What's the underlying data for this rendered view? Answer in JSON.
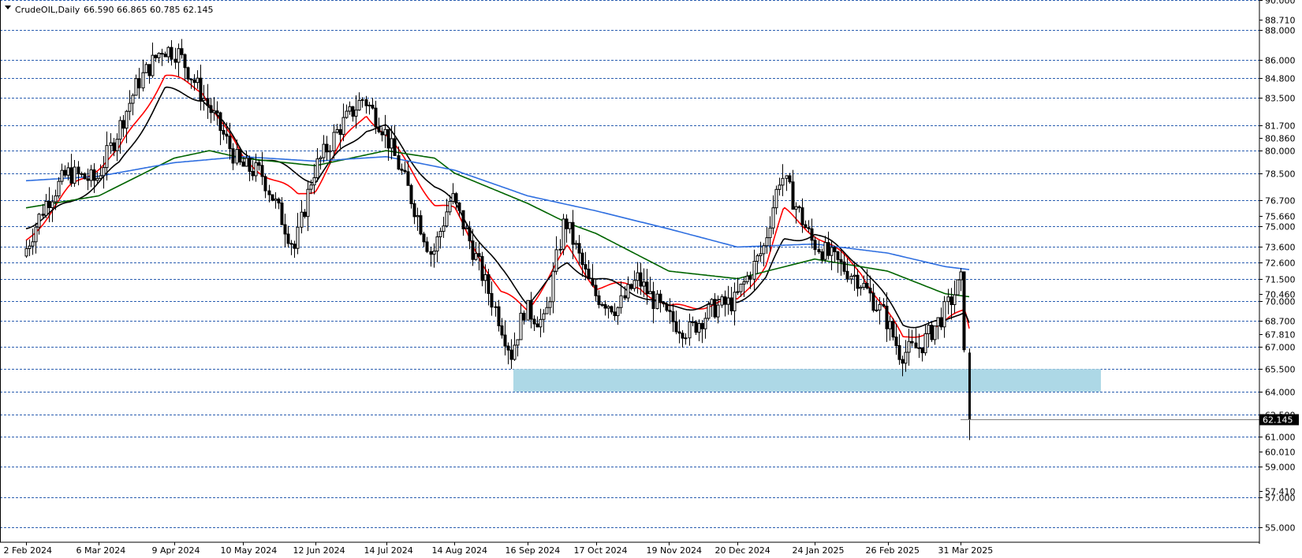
{
  "header": {
    "symbol": "CrudeOIL,Daily",
    "ohlc": "66.590 66.865 60.785 62.145",
    "menu_icon": "triangle-down-icon"
  },
  "colors": {
    "background": "#ffffff",
    "grid": "#2a5db0",
    "candle": "#000000",
    "ma_fast": "#ff0000",
    "ma_mid": "#000000",
    "ma_100": "#006400",
    "ma_200": "#2f6fe0",
    "support_zone": "#add8e6",
    "price_tag_bg": "#000000",
    "price_tag_fg": "#ffffff"
  },
  "chart_data": {
    "type": "line",
    "ylim": [
      54.0,
      90.0
    ],
    "grid": true,
    "price_levels": [
      "90.000",
      "88.000",
      "86.000",
      "84.800",
      "83.500",
      "81.700",
      "80.000",
      "78.500",
      "76.700",
      "75.000",
      "73.600",
      "72.600",
      "71.500",
      "70.000",
      "68.700",
      "67.000",
      "65.500",
      "64.000",
      "62.500",
      "61.000",
      "59.000",
      "57.000",
      "55.000"
    ],
    "marker_labels": [
      "88.710",
      "80.860",
      "75.660",
      "70.460",
      "67.810",
      "60.010",
      "57.410"
    ],
    "current_price": "62.145",
    "x_ticks": [
      "2 Feb 2024",
      "6 Mar 2024",
      "9 Apr 2024",
      "10 May 2024",
      "12 Jun 2024",
      "14 Jul 2024",
      "14 Aug 2024",
      "16 Sep 2024",
      "17 Oct 2024",
      "19 Nov 2024",
      "20 Dec 2024",
      "24 Jan 2025",
      "26 Feb 2025",
      "31 Mar 2025"
    ],
    "support_zone": {
      "low": 64.0,
      "high": 65.5
    },
    "price_path": [
      {
        "x": "2 Feb 2024",
        "y": 73.0
      },
      {
        "x": "12 Feb 2024",
        "y": 76.5
      },
      {
        "x": "22 Feb 2024",
        "y": 78.5
      },
      {
        "x": "6 Mar 2024",
        "y": 78.0
      },
      {
        "x": "15 Mar 2024",
        "y": 81.0
      },
      {
        "x": "25 Mar 2024",
        "y": 84.5
      },
      {
        "x": "5 Apr 2024",
        "y": 86.8
      },
      {
        "x": "12 Apr 2024",
        "y": 86.5
      },
      {
        "x": "22 Apr 2024",
        "y": 84.0
      },
      {
        "x": "1 May 2024",
        "y": 81.5
      },
      {
        "x": "10 May 2024",
        "y": 79.0
      },
      {
        "x": "20 May 2024",
        "y": 78.5
      },
      {
        "x": "4 Jun 2024",
        "y": 73.5
      },
      {
        "x": "12 Jun 2024",
        "y": 78.5
      },
      {
        "x": "24 Jun 2024",
        "y": 81.5
      },
      {
        "x": "5 Jul 2024",
        "y": 83.5
      },
      {
        "x": "14 Jul 2024",
        "y": 81.5
      },
      {
        "x": "25 Jul 2024",
        "y": 77.5
      },
      {
        "x": "5 Aug 2024",
        "y": 73.0
      },
      {
        "x": "14 Aug 2024",
        "y": 77.0
      },
      {
        "x": "22 Aug 2024",
        "y": 74.0
      },
      {
        "x": "4 Sep 2024",
        "y": 69.0
      },
      {
        "x": "10 Sep 2024",
        "y": 66.5
      },
      {
        "x": "16 Sep 2024",
        "y": 69.5
      },
      {
        "x": "25 Sep 2024",
        "y": 68.5
      },
      {
        "x": "4 Oct 2024",
        "y": 75.5
      },
      {
        "x": "17 Oct 2024",
        "y": 70.5
      },
      {
        "x": "28 Oct 2024",
        "y": 69.5
      },
      {
        "x": "6 Nov 2024",
        "y": 71.5
      },
      {
        "x": "19 Nov 2024",
        "y": 69.0
      },
      {
        "x": "29 Nov 2024",
        "y": 68.0
      },
      {
        "x": "10 Dec 2024",
        "y": 69.5
      },
      {
        "x": "20 Dec 2024",
        "y": 70.0
      },
      {
        "x": "2 Jan 2025",
        "y": 73.5
      },
      {
        "x": "10 Jan 2025",
        "y": 78.5
      },
      {
        "x": "24 Jan 2025",
        "y": 74.0
      },
      {
        "x": "5 Feb 2025",
        "y": 72.5
      },
      {
        "x": "14 Feb 2025",
        "y": 71.5
      },
      {
        "x": "26 Feb 2025",
        "y": 69.0
      },
      {
        "x": "5 Mar 2025",
        "y": 66.5
      },
      {
        "x": "14 Mar 2025",
        "y": 67.0
      },
      {
        "x": "24 Mar 2025",
        "y": 69.0
      },
      {
        "x": "2 Apr 2025",
        "y": 71.5
      },
      {
        "x": "4 Apr 2025",
        "y": 62.145
      }
    ],
    "series": [
      {
        "color": "#ff0000",
        "values": [
          {
            "x": "2 Feb 2024",
            "y": 74.0
          },
          {
            "x": "22 Feb 2024",
            "y": 77.5
          },
          {
            "x": "15 Mar 2024",
            "y": 80.0
          },
          {
            "x": "5 Apr 2024",
            "y": 85.0
          },
          {
            "x": "22 Apr 2024",
            "y": 84.0
          },
          {
            "x": "10 May 2024",
            "y": 79.5
          },
          {
            "x": "4 Jun 2024",
            "y": 77.0
          },
          {
            "x": "12 Jun 2024",
            "y": 77.5
          },
          {
            "x": "24 Jun 2024",
            "y": 80.5
          },
          {
            "x": "5 Jul 2024",
            "y": 82.5
          },
          {
            "x": "14 Jul 2024",
            "y": 81.0
          },
          {
            "x": "5 Aug 2024",
            "y": 76.5
          },
          {
            "x": "14 Aug 2024",
            "y": 76.0
          },
          {
            "x": "4 Sep 2024",
            "y": 70.5
          },
          {
            "x": "16 Sep 2024",
            "y": 69.5
          },
          {
            "x": "4 Oct 2024",
            "y": 73.5
          },
          {
            "x": "17 Oct 2024",
            "y": 71.0
          },
          {
            "x": "6 Nov 2024",
            "y": 71.0
          },
          {
            "x": "19 Nov 2024",
            "y": 69.5
          },
          {
            "x": "20 Dec 2024",
            "y": 70.0
          },
          {
            "x": "2 Jan 2025",
            "y": 72.5
          },
          {
            "x": "10 Jan 2025",
            "y": 76.0
          },
          {
            "x": "24 Jan 2025",
            "y": 74.5
          },
          {
            "x": "14 Feb 2025",
            "y": 72.0
          },
          {
            "x": "5 Mar 2025",
            "y": 67.5
          },
          {
            "x": "24 Mar 2025",
            "y": 68.5
          },
          {
            "x": "2 Apr 2025",
            "y": 69.5
          },
          {
            "x": "4 Apr 2025",
            "y": 68.3
          }
        ]
      },
      {
        "color": "#000000",
        "values": [
          {
            "x": "2 Feb 2024",
            "y": 75.0
          },
          {
            "x": "22 Feb 2024",
            "y": 76.5
          },
          {
            "x": "15 Mar 2024",
            "y": 79.0
          },
          {
            "x": "5 Apr 2024",
            "y": 84.0
          },
          {
            "x": "22 Apr 2024",
            "y": 83.5
          },
          {
            "x": "10 May 2024",
            "y": 80.0
          },
          {
            "x": "4 Jun 2024",
            "y": 78.5
          },
          {
            "x": "12 Jun 2024",
            "y": 78.0
          },
          {
            "x": "24 Jun 2024",
            "y": 80.0
          },
          {
            "x": "5 Jul 2024",
            "y": 81.5
          },
          {
            "x": "14 Jul 2024",
            "y": 81.5
          },
          {
            "x": "5 Aug 2024",
            "y": 77.5
          },
          {
            "x": "14 Aug 2024",
            "y": 76.5
          },
          {
            "x": "4 Sep 2024",
            "y": 72.0
          },
          {
            "x": "16 Sep 2024",
            "y": 70.0
          },
          {
            "x": "4 Oct 2024",
            "y": 72.5
          },
          {
            "x": "17 Oct 2024",
            "y": 71.5
          },
          {
            "x": "6 Nov 2024",
            "y": 70.5
          },
          {
            "x": "19 Nov 2024",
            "y": 69.5
          },
          {
            "x": "20 Dec 2024",
            "y": 70.0
          },
          {
            "x": "2 Jan 2025",
            "y": 71.5
          },
          {
            "x": "10 Jan 2025",
            "y": 74.0
          },
          {
            "x": "24 Jan 2025",
            "y": 74.5
          },
          {
            "x": "14 Feb 2025",
            "y": 72.5
          },
          {
            "x": "5 Mar 2025",
            "y": 68.5
          },
          {
            "x": "24 Mar 2025",
            "y": 68.5
          },
          {
            "x": "2 Apr 2025",
            "y": 69.5
          },
          {
            "x": "4 Apr 2025",
            "y": 68.8
          }
        ]
      },
      {
        "color": "#006400",
        "values": [
          {
            "x": "2 Feb 2024",
            "y": 76.2
          },
          {
            "x": "6 Mar 2024",
            "y": 77.0
          },
          {
            "x": "9 Apr 2024",
            "y": 79.5
          },
          {
            "x": "25 Apr 2024",
            "y": 80.0
          },
          {
            "x": "10 May 2024",
            "y": 79.5
          },
          {
            "x": "12 Jun 2024",
            "y": 79.0
          },
          {
            "x": "14 Jul 2024",
            "y": 80.0
          },
          {
            "x": "5 Aug 2024",
            "y": 79.5
          },
          {
            "x": "14 Aug 2024",
            "y": 78.5
          },
          {
            "x": "16 Sep 2024",
            "y": 76.5
          },
          {
            "x": "4 Oct 2024",
            "y": 75.2
          },
          {
            "x": "17 Oct 2024",
            "y": 74.5
          },
          {
            "x": "19 Nov 2024",
            "y": 72.0
          },
          {
            "x": "20 Dec 2024",
            "y": 71.5
          },
          {
            "x": "24 Jan 2025",
            "y": 72.8
          },
          {
            "x": "26 Feb 2025",
            "y": 72.0
          },
          {
            "x": "24 Mar 2025",
            "y": 70.5
          },
          {
            "x": "4 Apr 2025",
            "y": 70.3
          }
        ]
      },
      {
        "color": "#2f6fe0",
        "values": [
          {
            "x": "2 Feb 2024",
            "y": 78.0
          },
          {
            "x": "6 Mar 2024",
            "y": 78.3
          },
          {
            "x": "9 Apr 2024",
            "y": 79.2
          },
          {
            "x": "10 May 2024",
            "y": 79.6
          },
          {
            "x": "12 Jun 2024",
            "y": 79.3
          },
          {
            "x": "14 Jul 2024",
            "y": 79.6
          },
          {
            "x": "14 Aug 2024",
            "y": 78.7
          },
          {
            "x": "16 Sep 2024",
            "y": 77.0
          },
          {
            "x": "17 Oct 2024",
            "y": 76.0
          },
          {
            "x": "19 Nov 2024",
            "y": 74.8
          },
          {
            "x": "20 Dec 2024",
            "y": 73.6
          },
          {
            "x": "24 Jan 2025",
            "y": 73.8
          },
          {
            "x": "26 Feb 2025",
            "y": 73.2
          },
          {
            "x": "24 Mar 2025",
            "y": 72.3
          },
          {
            "x": "4 Apr 2025",
            "y": 72.1
          }
        ]
      }
    ]
  }
}
